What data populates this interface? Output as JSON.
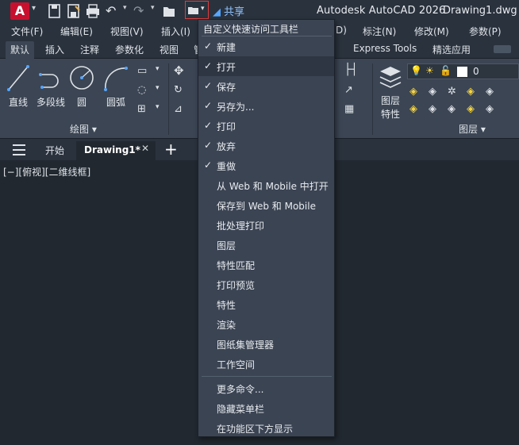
{
  "title": {
    "app": "Autodesk AutoCAD 2026",
    "file": "Drawing1.dwg",
    "logo": "A",
    "share": "共享"
  },
  "menu": [
    "文件(F)",
    "编辑(E)",
    "视图(V)",
    "插入(I)",
    "D)",
    "标注(N)",
    "修改(M)",
    "参数(P)"
  ],
  "tabs": [
    "默认",
    "插入",
    "注释",
    "参数化",
    "视图",
    "管",
    "Express Tools",
    "精选应用"
  ],
  "ribbon": {
    "tools": [
      "直线",
      "多段线",
      "圆",
      "圆弧"
    ],
    "draw_panel": "绘图 ▾",
    "layer_props": [
      "图层",
      "特性"
    ],
    "layer_panel": "图层 ▾",
    "layer_value": "0"
  },
  "doc_tabs": {
    "start": "开始",
    "active": "Drawing1*",
    "close": "✕",
    "add": "+"
  },
  "viewport_label": "[−][俯视][二维线框]",
  "dropdown": {
    "header": "自定义快速访问工具栏",
    "items": [
      {
        "label": "新建",
        "checked": "✓"
      },
      {
        "label": "打开",
        "checked": "✓"
      },
      {
        "label": "保存",
        "checked": "✓"
      },
      {
        "label": "另存为...",
        "checked": "✓"
      },
      {
        "label": "打印",
        "checked": "✓"
      },
      {
        "label": "放弃",
        "checked": "✓"
      },
      {
        "label": "重做",
        "checked": "✓"
      },
      {
        "label": "从 Web 和 Mobile 中打开",
        "checked": ""
      },
      {
        "label": "保存到 Web 和 Mobile",
        "checked": ""
      },
      {
        "label": "批处理打印",
        "checked": ""
      },
      {
        "label": "图层",
        "checked": ""
      },
      {
        "label": "特性匹配",
        "checked": ""
      },
      {
        "label": "打印预览",
        "checked": ""
      },
      {
        "label": "特性",
        "checked": ""
      },
      {
        "label": "渲染",
        "checked": ""
      },
      {
        "label": "图纸集管理器",
        "checked": ""
      },
      {
        "label": "工作空间",
        "checked": ""
      }
    ],
    "extra": [
      "更多命令...",
      "隐藏菜单栏",
      "在功能区下方显示"
    ]
  }
}
